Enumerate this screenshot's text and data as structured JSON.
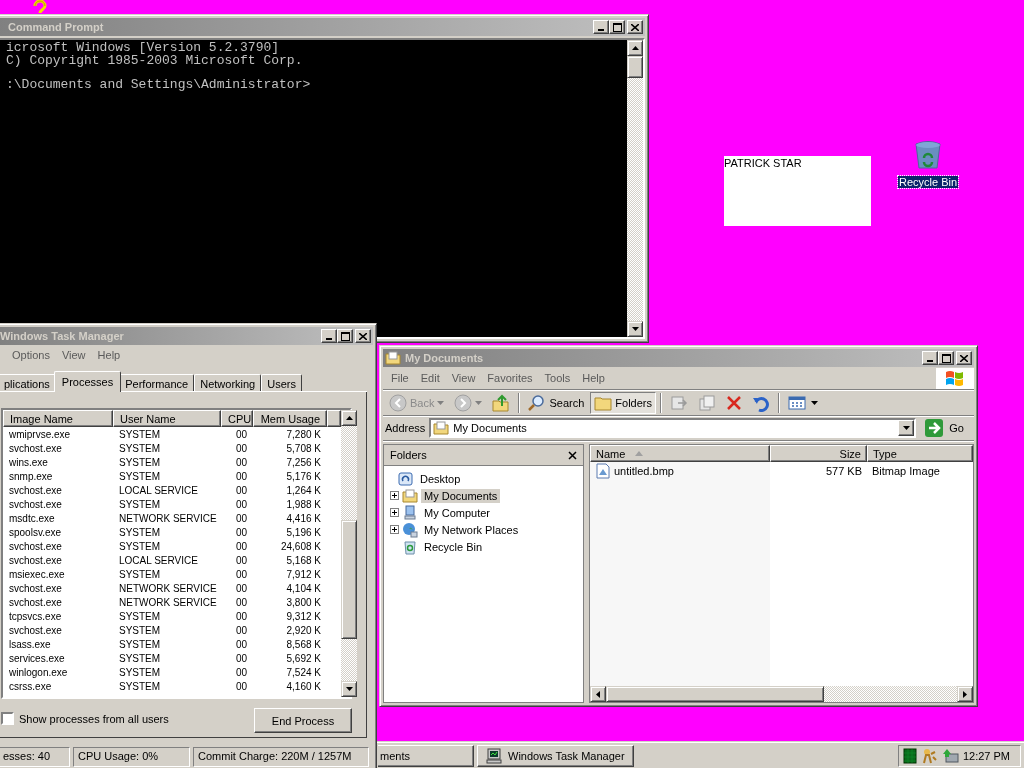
{
  "command_prompt": {
    "title": "Command Prompt",
    "lines": [
      "icrosoft Windows [Version 5.2.3790]",
      "C) Copyright 1985-2003 Microsoft Corp."
    ],
    "prompt": ":\\Documents and Settings\\Administrator>"
  },
  "desktop": {
    "note": "PATRICK STAR",
    "icons": [
      {
        "label": "Recycle Bin",
        "selected": true
      }
    ]
  },
  "task_manager": {
    "title": "Windows Task Manager",
    "menu": [
      "Options",
      "View",
      "Help"
    ],
    "tabs": [
      {
        "label": "plications",
        "selected": false
      },
      {
        "label": "Processes",
        "selected": true
      },
      {
        "label": "Performance",
        "selected": false
      },
      {
        "label": "Networking",
        "selected": false
      },
      {
        "label": "Users",
        "selected": false
      }
    ],
    "columns": [
      "Image Name",
      "User Name",
      "CPU",
      "Mem Usage"
    ],
    "rows": [
      [
        "wmiprvse.exe",
        "SYSTEM",
        "00",
        "7,280 K"
      ],
      [
        "svchost.exe",
        "SYSTEM",
        "00",
        "5,708 K"
      ],
      [
        "wins.exe",
        "SYSTEM",
        "00",
        "7,256 K"
      ],
      [
        "snmp.exe",
        "SYSTEM",
        "00",
        "5,176 K"
      ],
      [
        "svchost.exe",
        "LOCAL SERVICE",
        "00",
        "1,264 K"
      ],
      [
        "svchost.exe",
        "SYSTEM",
        "00",
        "1,988 K"
      ],
      [
        "msdtc.exe",
        "NETWORK SERVICE",
        "00",
        "4,416 K"
      ],
      [
        "spoolsv.exe",
        "SYSTEM",
        "00",
        "5,196 K"
      ],
      [
        "svchost.exe",
        "SYSTEM",
        "00",
        "24,608 K"
      ],
      [
        "svchost.exe",
        "LOCAL SERVICE",
        "00",
        "5,168 K"
      ],
      [
        "msiexec.exe",
        "SYSTEM",
        "00",
        "7,912 K"
      ],
      [
        "svchost.exe",
        "NETWORK SERVICE",
        "00",
        "4,104 K"
      ],
      [
        "svchost.exe",
        "NETWORK SERVICE",
        "00",
        "3,800 K"
      ],
      [
        "tcpsvcs.exe",
        "SYSTEM",
        "00",
        "9,312 K"
      ],
      [
        "svchost.exe",
        "SYSTEM",
        "00",
        "2,920 K"
      ],
      [
        "lsass.exe",
        "SYSTEM",
        "00",
        "8,568 K"
      ],
      [
        "services.exe",
        "SYSTEM",
        "00",
        "5,692 K"
      ],
      [
        "winlogon.exe",
        "SYSTEM",
        "00",
        "7,524 K"
      ],
      [
        "csrss.exe",
        "SYSTEM",
        "00",
        "4,160 K"
      ]
    ],
    "show_all_users": {
      "label": "Show processes from all users",
      "checked": false
    },
    "end_button": "End Process",
    "status_bar": [
      "esses: 40",
      "CPU Usage: 0%",
      "Commit Charge: 220M / 1257M"
    ]
  },
  "explorer": {
    "title": "My Documents",
    "menu": [
      "File",
      "Edit",
      "View",
      "Favorites",
      "Tools",
      "Help"
    ],
    "toolbar": {
      "back": "Back",
      "search": "Search",
      "folders": "Folders",
      "folders_pressed": true
    },
    "address": {
      "label": "Address",
      "value": "My Documents",
      "go": "Go"
    },
    "folders_pane": {
      "title": "Folders",
      "tree": [
        {
          "label": "Desktop",
          "kind": "desktop",
          "selected": false,
          "expandable": false,
          "children": [
            {
              "label": "My Documents",
              "kind": "documents",
              "selected": true,
              "expandable": true
            },
            {
              "label": "My Computer",
              "kind": "computer",
              "selected": false,
              "expandable": true
            },
            {
              "label": "My Network Places",
              "kind": "network",
              "selected": false,
              "expandable": true
            },
            {
              "label": "Recycle Bin",
              "kind": "recycle",
              "selected": false,
              "expandable": false
            }
          ]
        }
      ]
    },
    "files": {
      "columns": [
        {
          "label": "Name",
          "sorted": true
        },
        {
          "label": "Size",
          "sorted": false
        },
        {
          "label": "Type",
          "sorted": false
        }
      ],
      "rows": [
        {
          "name": "untitled.bmp",
          "size": "577 KB",
          "type": "Bitmap Image"
        }
      ]
    }
  },
  "taskbar": {
    "buttons": [
      {
        "label": "ments"
      },
      {
        "label": "Windows Task Manager",
        "kind": "task-manager"
      }
    ],
    "clock": "12:27 PM"
  }
}
